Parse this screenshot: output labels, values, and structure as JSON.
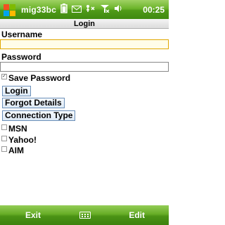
{
  "statusbar": {
    "title": "mig33bc",
    "clock": "00:25",
    "icons": [
      "windows-start-icon",
      "battery-icon",
      "message-icon",
      "connectivity-icon",
      "signal-icon",
      "volume-icon"
    ]
  },
  "form": {
    "header": "Login",
    "username_label": "Username",
    "username_value": "",
    "password_label": "Password",
    "password_value": "",
    "save_password_label": "Save Password",
    "save_password_checked": true,
    "login_button": "Login",
    "forgot_button": "Forgot Details",
    "connection_button": "Connection Type",
    "connections": [
      {
        "label": "MSN",
        "checked": false
      },
      {
        "label": "Yahoo!",
        "checked": false
      },
      {
        "label": "AIM",
        "checked": false
      }
    ]
  },
  "softkeys": {
    "left": "Exit",
    "right": "Edit"
  },
  "colors": {
    "bar_green": "#5aa51f",
    "button_border": "#6b8fb8",
    "focus_border": "#e0a800"
  }
}
